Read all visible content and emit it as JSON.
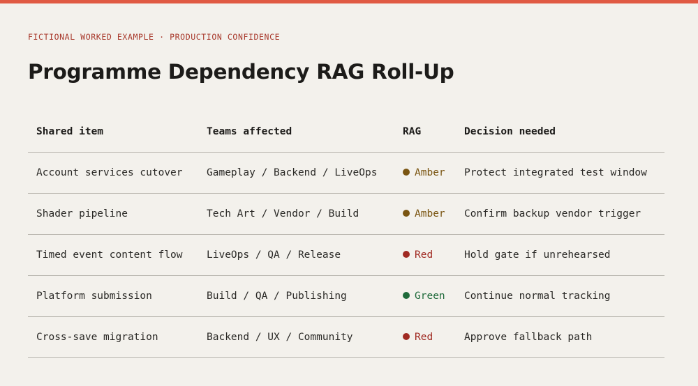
{
  "header": {
    "eyebrow": "FICTIONAL WORKED EXAMPLE · PRODUCTION CONFIDENCE",
    "title": "Programme Dependency RAG Roll-Up"
  },
  "colors": {
    "accent_bar": "#e05a43",
    "eyebrow": "#a8392c",
    "amber": "#7a5511",
    "red": "#a02a22",
    "green": "#1e6a3a"
  },
  "table": {
    "columns": [
      "Shared item",
      "Teams affected",
      "RAG",
      "Decision needed"
    ],
    "rows": [
      {
        "item": "Account services cutover",
        "teams": "Gameplay / Backend / LiveOps",
        "rag": "Amber",
        "status": "amber",
        "decision": "Protect integrated test window"
      },
      {
        "item": "Shader pipeline",
        "teams": "Tech Art / Vendor / Build",
        "rag": "Amber",
        "status": "amber",
        "decision": "Confirm backup vendor trigger"
      },
      {
        "item": "Timed event content flow",
        "teams": "LiveOps / QA / Release",
        "rag": "Red",
        "status": "red",
        "decision": "Hold gate if unrehearsed"
      },
      {
        "item": "Platform submission",
        "teams": "Build / QA / Publishing",
        "rag": "Green",
        "status": "green",
        "decision": "Continue normal tracking"
      },
      {
        "item": "Cross-save migration",
        "teams": "Backend / UX / Community",
        "rag": "Red",
        "status": "red",
        "decision": "Approve fallback path"
      }
    ]
  }
}
